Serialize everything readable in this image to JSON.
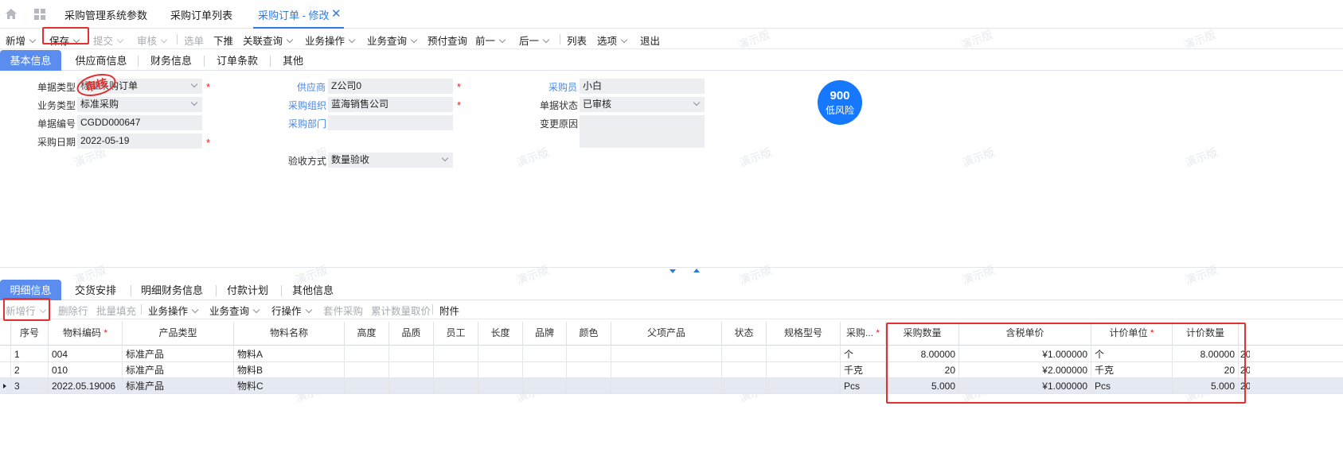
{
  "tabbar": {
    "tabs": [
      "采购管理系统参数",
      "采购订单列表",
      "采购订单 - 修改"
    ]
  },
  "toolbar": {
    "items": [
      "新增",
      "保存",
      "提交",
      "审核",
      "选单",
      "下推",
      "关联查询",
      "业务操作",
      "业务查询",
      "预付查询",
      "前一",
      "后一",
      "列表",
      "选项",
      "退出"
    ]
  },
  "header_tabs": [
    "基本信息",
    "供应商信息",
    "财务信息",
    "订单条款",
    "其他"
  ],
  "form": {
    "doc_type": {
      "label": "单据类型",
      "value": "标准采购订单",
      "stamp": "审核"
    },
    "biz_type": {
      "label": "业务类型",
      "value": "标准采购"
    },
    "doc_no": {
      "label": "单据编号",
      "value": "CGDD000647"
    },
    "purchase_date": {
      "label": "采购日期",
      "value": "2022-05-19"
    },
    "supplier": {
      "label": "供应商",
      "value": "Z公司0"
    },
    "purchase_org": {
      "label": "采购组织",
      "value": "蓝海销售公司"
    },
    "purchase_dept": {
      "label": "采购部门",
      "value": ""
    },
    "inspection": {
      "label": "验收方式",
      "value": "数量验收"
    },
    "buyer": {
      "label": "采购员",
      "value": "小白"
    },
    "doc_status": {
      "label": "单据状态",
      "value": "已审核"
    },
    "change_reason": {
      "label": "变更原因",
      "value": ""
    },
    "risk": {
      "score": "900",
      "label": "低风险"
    }
  },
  "watermark": "演示版",
  "detail_tabs": [
    "明细信息",
    "交货安排",
    "明细财务信息",
    "付款计划",
    "其他信息"
  ],
  "detail_toolbar": {
    "items": [
      "新增行",
      "删除行",
      "批量填充",
      "业务操作",
      "业务查询",
      "行操作",
      "套件采购",
      "累计数量取价",
      "附件"
    ]
  },
  "grid": {
    "columns": [
      "序号",
      "物料编码",
      "产品类型",
      "物料名称",
      "高度",
      "品质",
      "员工",
      "长度",
      "品牌",
      "颜色",
      "父项产品",
      "状态",
      "规格型号",
      "采购...",
      "采购数量",
      "含税单价",
      "计价单位",
      "计价数量"
    ],
    "rows": [
      [
        "1",
        "004",
        "标准产品",
        "物料A",
        "",
        "",
        "",
        "",
        "",
        "",
        "",
        "",
        "",
        "个",
        "8.00000",
        "¥1.000000",
        "个",
        "8.00000"
      ],
      [
        "2",
        "010",
        "标准产品",
        "物料B",
        "",
        "",
        "",
        "",
        "",
        "",
        "",
        "",
        "",
        "千克",
        "20",
        "¥2.000000",
        "千克",
        "20"
      ],
      [
        "3",
        "2022.05.19006",
        "标准产品",
        "物料C",
        "",
        "",
        "",
        "",
        "",
        "",
        "",
        "",
        "",
        "Pcs",
        "5.000",
        "¥1.000000",
        "Pcs",
        "5.000"
      ]
    ],
    "overflow_text": "20"
  }
}
